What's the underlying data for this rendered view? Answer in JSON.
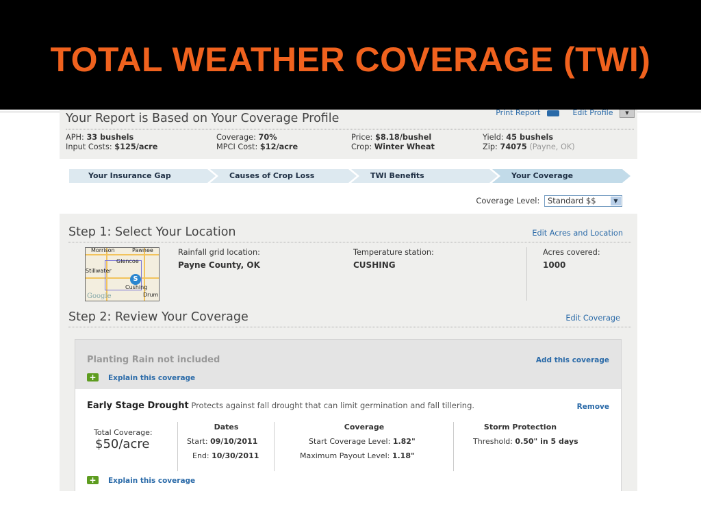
{
  "slide_title": "TOTAL WEATHER COVERAGE (TWI)",
  "profile": {
    "title": "Your Report is Based on Your Coverage Profile",
    "print_report": "Print Report",
    "edit_profile": "Edit Profile",
    "fields": {
      "aph_label": "APH:",
      "aph_value": "33 bushels",
      "input_label": "Input Costs:",
      "input_value": "$125/acre",
      "coverage_label": "Coverage:",
      "coverage_value": "70%",
      "mpci_label": "MPCI Cost:",
      "mpci_value": "$12/acre",
      "price_label": "Price:",
      "price_value": "$8.18/bushel",
      "crop_label": "Crop:",
      "crop_value": "Winter Wheat",
      "yield_label": "Yield:",
      "yield_value": "45 bushels",
      "zip_label": "Zip:",
      "zip_value": "74075",
      "zip_note": "(Payne, OK)"
    }
  },
  "steps": [
    {
      "label": "Your Insurance Gap"
    },
    {
      "label": "Causes of Crop Loss"
    },
    {
      "label": "TWI Benefits"
    },
    {
      "label": "Your Coverage"
    }
  ],
  "coverage_level": {
    "label": "Coverage Level:",
    "value": "Standard $$"
  },
  "step1": {
    "title": "Step 1: Select Your Location",
    "edit_link": "Edit Acres and Location",
    "map_labels": {
      "morrison": "Morrison",
      "pawnee": "Pawnee",
      "glencoe": "Glencoe",
      "stillwater": "Stillwater",
      "cushing": "Cushing",
      "drum": "Drum",
      "google": "Google",
      "pin": "S"
    },
    "rainfall_label": "Rainfall grid location:",
    "rainfall_value": "Payne County, OK",
    "temp_label": "Temperature station:",
    "temp_value": "CUSHING",
    "acres_label": "Acres covered:",
    "acres_value": "1000"
  },
  "step2": {
    "title": "Step 2: Review Your Coverage",
    "edit_link": "Edit Coverage",
    "excluded": {
      "title": "Planting Rain not included",
      "add_link": "Add this coverage",
      "explain": "Explain this coverage"
    },
    "drought": {
      "name": "Early Stage Drought",
      "description": "Protects against fall drought that can limit germination and fall tillering.",
      "remove": "Remove",
      "total_label": "Total Coverage:",
      "total_value": "$50/acre",
      "dates_header": "Dates",
      "start_label": "Start:",
      "start_value": "09/10/2011",
      "end_label": "End:",
      "end_value": "10/30/2011",
      "coverage_header": "Coverage",
      "start_level_label": "Start Coverage Level:",
      "start_level_value": "1.82\"",
      "max_payout_label": "Maximum Payout Level:",
      "max_payout_value": "1.18\"",
      "storm_header": "Storm Protection",
      "threshold_label": "Threshold:",
      "threshold_value": "0.50\" in 5 days",
      "explain": "Explain this coverage"
    }
  }
}
